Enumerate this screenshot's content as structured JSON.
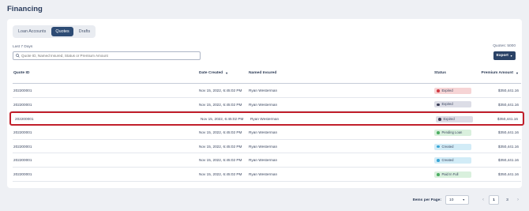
{
  "page": {
    "title": "Financing"
  },
  "tabs": [
    {
      "label": "Loan Accounts",
      "active": false
    },
    {
      "label": "Quotes",
      "active": true
    },
    {
      "label": "Drafts",
      "active": false
    }
  ],
  "filter": {
    "range_label": "Last 7 Days",
    "search_placeholder": "Quote ID, Named Insured, Status or Premium Amount"
  },
  "summary": {
    "quotes_count": "Quotes: 5000"
  },
  "toolbar": {
    "export_label": "Export"
  },
  "table": {
    "columns": [
      "Quote ID",
      "Date Created",
      "Named Insured",
      "Status",
      "Premium Amount"
    ],
    "rows": [
      {
        "id": "202200001",
        "date": "Nov 15, 2022, 6:45:02 PM",
        "name": "Ryan Westerman",
        "status": "Expired",
        "amount": "$350,441.16"
      },
      {
        "id": "202200001",
        "date": "Nov 15, 2022, 6:45:02 PM",
        "name": "Ryan Westerman",
        "status": "Expired",
        "amount": "$350,441.16"
      },
      {
        "id": "202200001",
        "date": "Nov 15, 2022, 6:45:02 PM",
        "name": "Ryan Westerman",
        "status": "Expired",
        "amount": "$350,441.16"
      },
      {
        "id": "202200001",
        "date": "Nov 15, 2022, 6:45:02 PM",
        "name": "Ryan Westerman",
        "status": "Pending Loan",
        "amount": "$350,441.16"
      },
      {
        "id": "202200001",
        "date": "Nov 15, 2022, 6:45:02 PM",
        "name": "Ryan Westerman",
        "status": "Created",
        "amount": "$350,441.16"
      },
      {
        "id": "202200001",
        "date": "Nov 15, 2022, 6:45:02 PM",
        "name": "Ryan Westerman",
        "status": "Created",
        "amount": "$350,441.16"
      },
      {
        "id": "202200001",
        "date": "Nov 15, 2022, 6:45:02 PM",
        "name": "Ryan Westerman",
        "status": "Paid In Full",
        "amount": "$350,441.16"
      }
    ]
  },
  "status_colors": {
    "expired_red": "#d23c45",
    "expired_gray": "#3c3f58",
    "pending": "#4dae63",
    "created": "#3aa6d6",
    "paid": "#4dae63",
    "highlight_border": "#c11f2b"
  },
  "pagination": {
    "label": "Items per Page:",
    "per_page": "10",
    "pages": [
      "1",
      "3"
    ],
    "current": "1"
  }
}
